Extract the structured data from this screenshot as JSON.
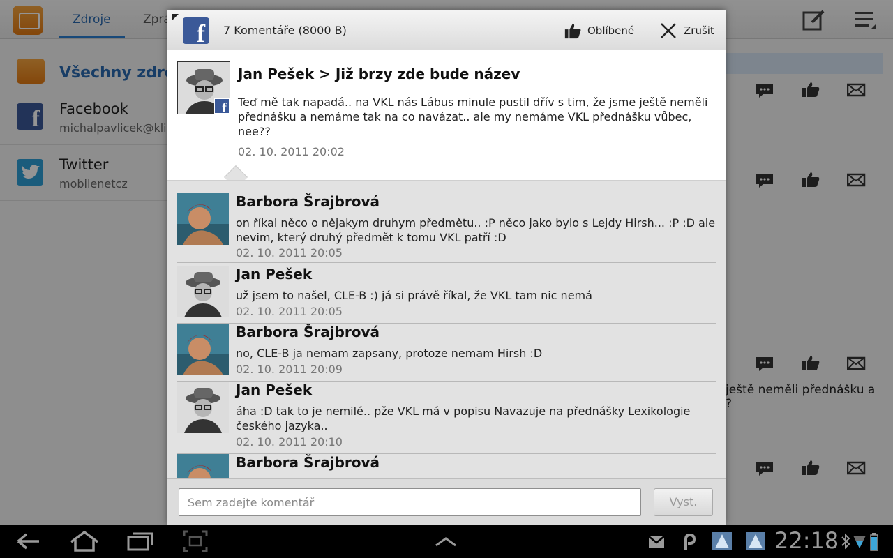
{
  "background": {
    "tabs": [
      "Zdroje",
      "Zprá"
    ],
    "all_sources_label": "Všechny zdroj",
    "sources": [
      {
        "name": "Facebook",
        "account": "michalpavlicek@kli",
        "icon": "facebook-icon"
      },
      {
        "name": "Twitter",
        "account": "mobilenetcz",
        "icon": "twitter-icon"
      }
    ],
    "feed_text_line1": "ještě neměli přednášku a",
    "feed_text_line2": "?"
  },
  "dialog": {
    "title": "7 Komentáře (8000 B)",
    "like_label": "Oblíbené",
    "cancel_label": "Zrušit",
    "post": {
      "author_title": "Jan Pešek > Již brzy zde bude název",
      "text": "Teď mě tak napadá.. na VKL nás Lábus minule pustil dřív s tim, že jsme ještě neměli přednášku a nemáme tak na co navázat.. ale my nemáme VKL přednášku vůbec, nee??",
      "time": "02. 10. 2011 20:02"
    },
    "comments": [
      {
        "author": "Barbora Šrajbrová",
        "text": "on říkal něco o nějakym druhym předmětu.. :P něco jako bylo s Lejdy Hirsh... :P :D ale nevim, který druhý předmět k tomu VKL patří :D",
        "time": "02. 10. 2011 20:05"
      },
      {
        "author": "Jan Pešek",
        "text": "už jsem to našel, CLE-B :) já si právě říkal, že VKL tam nic nemá",
        "time": "02. 10. 2011 20:05"
      },
      {
        "author": "Barbora Šrajbrová",
        "text": "no, CLE-B ja nemam zapsany, protoze nemam Hirsh :D",
        "time": "02. 10. 2011 20:09"
      },
      {
        "author": "Jan Pešek",
        "text": "áha :D tak to je nemilé.. pže VKL má v popisu Navazuje na přednášky Lexikologie českého jazyka..",
        "time": "02. 10. 2011 20:10"
      },
      {
        "author": "Barbora Šrajbrová",
        "text": "",
        "time": ""
      }
    ],
    "input_placeholder": "Sem zadejte komentář",
    "send_label": "Vyst."
  },
  "system_bar": {
    "time": "22:18"
  },
  "colors": {
    "accent": "#2a6ab0",
    "facebook": "#3b5998",
    "twitter": "#2e9fd6"
  }
}
